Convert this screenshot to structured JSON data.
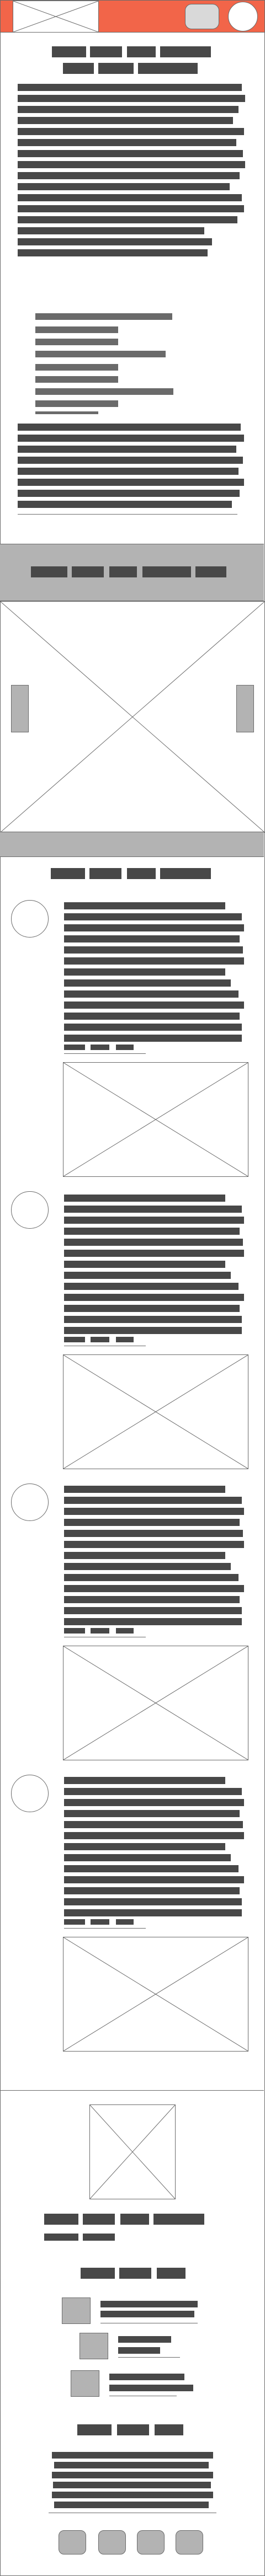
{
  "header": {
    "background_color": "#f26549",
    "logo_icon": "image-placeholder-icon",
    "search_button_icon": "rounded-rect-icon",
    "profile_icon": "circle-icon"
  },
  "colors": {
    "text_bar": "#484848",
    "muted_bar": "#6a6a6a",
    "band": "#b3b3b3",
    "outline": "#6a6a6a"
  },
  "hero_article": {
    "heading_lines": 2,
    "paragraph_lines": 15,
    "list_items": 9,
    "closing_lines": 8
  },
  "image_carousel": {
    "nav_items": 5,
    "image_icon": "image-placeholder-icon",
    "prev_icon": "slider-handle-icon",
    "next_icon": "slider-handle-icon"
  },
  "feed": {
    "section_title_words": 4,
    "posts": [
      {
        "avatar_icon": "avatar-circle-icon",
        "text_lines": 13,
        "tags": 4,
        "image_icon": "image-placeholder-icon"
      },
      {
        "avatar_icon": "avatar-circle-icon",
        "text_lines": 13,
        "tags": 4,
        "image_icon": "image-placeholder-icon"
      },
      {
        "avatar_icon": "avatar-circle-icon",
        "text_lines": 13,
        "tags": 4,
        "image_icon": "image-placeholder-icon"
      },
      {
        "avatar_icon": "avatar-circle-icon",
        "text_lines": 13,
        "tags": 4,
        "image_icon": "image-placeholder-icon"
      }
    ]
  },
  "footer": {
    "logo_icon": "image-placeholder-icon",
    "link_rows": 2,
    "featured_items": 3,
    "social_buttons": 4,
    "social_icon": "rounded-rect-icon"
  }
}
